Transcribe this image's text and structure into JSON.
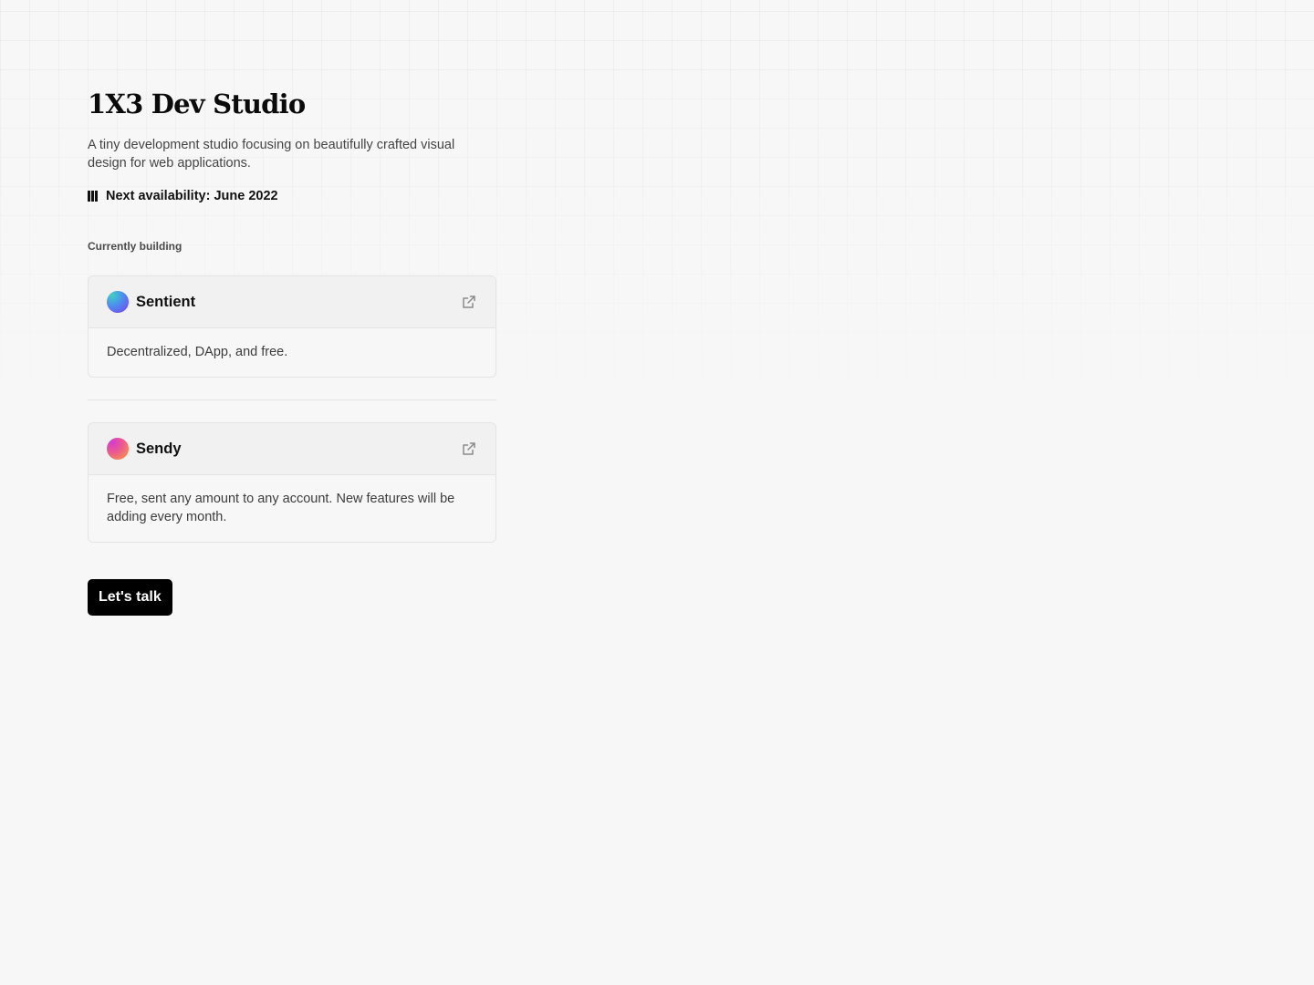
{
  "hero": {
    "title": "1X3 Dev Studio",
    "description": "A tiny development studio focusing on beautifully crafted visual design for web applications.",
    "availability": "Next availability: June 2022",
    "availability_icon": "calendar-bars-icon"
  },
  "projects": {
    "section_label": "Currently building",
    "items": [
      {
        "name": "Sentient",
        "description": "Decentralized, DApp, and free.",
        "logo_gradient": [
          "#3bd1c4",
          "#7b3cf2"
        ],
        "link_icon": "external-link-icon"
      },
      {
        "name": "Sendy",
        "description": "Free, sent any amount to any account. New features will be adding every month.",
        "logo_gradient": [
          "#e63fa8",
          "#f7a23a"
        ],
        "link_icon": "external-link-icon"
      }
    ]
  },
  "cta": {
    "label": "Let's talk"
  },
  "colors": {
    "background": "#f7f7f7",
    "text": "#111111",
    "button": "#000000",
    "button_text": "#ffffff",
    "border": "#e4e4e4"
  }
}
